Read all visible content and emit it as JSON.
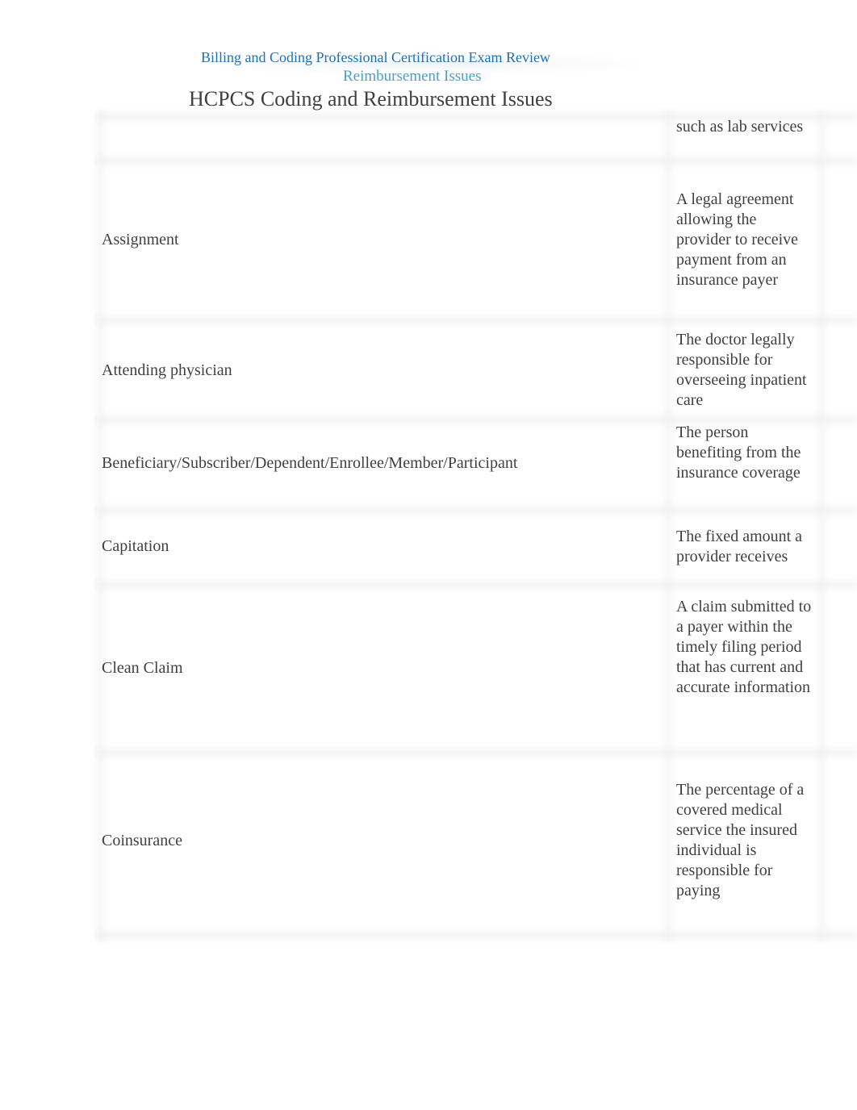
{
  "header": {
    "course_title": "Billing and Coding Professional Certification Exam Review",
    "section_title": "Reimbursement Issues",
    "page_title": "HCPCS Coding and Reimbursement Issues"
  },
  "glossary": {
    "rows": [
      {
        "term": "",
        "definition": "such as lab services"
      },
      {
        "term": "Assignment",
        "definition": "A legal agreement allowing the provider to receive payment from an insurance payer"
      },
      {
        "term": "Attending physician",
        "definition": "The doctor legally responsible for overseeing inpatient care"
      },
      {
        "term": "Beneficiary/Subscriber/Dependent/Enrollee/Member/Participant",
        "definition": "The person benefiting from the insurance coverage"
      },
      {
        "term": "Capitation",
        "definition": "The fixed amount a provider receives"
      },
      {
        "term": "Clean Claim",
        "definition": "A claim submitted to a payer within the timely filing period that has current and accurate information"
      },
      {
        "term": "Coinsurance",
        "definition": "The percentage of a covered medical service the insured individual is responsible for paying"
      }
    ]
  },
  "colors": {
    "course_title": "#1f6fb2",
    "section_title": "#4aa0c8",
    "body_text": "#404040"
  }
}
